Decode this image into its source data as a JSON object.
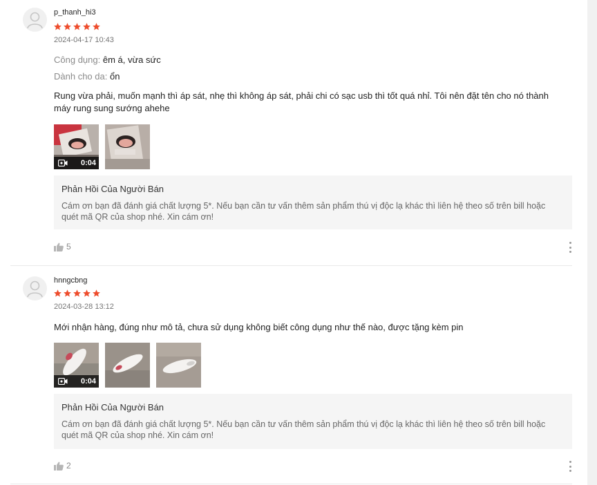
{
  "colors": {
    "star": "#ee4d2d",
    "seller_bg": "#f5f5f5",
    "muted": "#757575"
  },
  "reviews": [
    {
      "username": "p_thanh_hi3",
      "rating": 5,
      "timestamp": "2024-04-17 10:43",
      "attributes": [
        {
          "key": "Công dụng:",
          "value": "êm á, vừa sức"
        },
        {
          "key": "Dành cho da:",
          "value": "ổn"
        }
      ],
      "comment": "Rung vừa phải, muốn mạnh thì áp sát, nhẹ thì không áp sát, phải chi có sạc usb thì tốt quá nhỉ. Tôi nên đặt tên cho nó thành máy rung sung sướng ahehe",
      "media": [
        {
          "type": "video",
          "duration": "0:04"
        },
        {
          "type": "image"
        }
      ],
      "seller_reply": {
        "title": "Phản Hồi Của Người Bán",
        "text": "Cám ơn bạn đã đánh giá chất lượng 5*. Nếu bạn cần tư vấn thêm sản phẩm thú vị độc lạ khác thì liên hệ theo số trên bill hoặc quét mã QR của shop nhé. Xin cám ơn!"
      },
      "likes": "5"
    },
    {
      "username": "hnngcbng",
      "rating": 5,
      "timestamp": "2024-03-28 13:12",
      "comment": "Mới nhận hàng, đúng như mô tả, chưa sử dụng không biết công dụng như thế nào, được tặng kèm pin",
      "media": [
        {
          "type": "video",
          "duration": "0:04"
        },
        {
          "type": "image"
        },
        {
          "type": "image"
        }
      ],
      "seller_reply": {
        "title": "Phản Hồi Của Người Bán",
        "text": "Cám ơn bạn đã đánh giá chất lượng 5*. Nếu bạn cần tư vấn thêm sản phẩm thú vị độc lạ khác thì liên hệ theo số trên bill hoặc quét mã QR của shop nhé. Xin cám ơn!"
      },
      "likes": "2"
    }
  ]
}
